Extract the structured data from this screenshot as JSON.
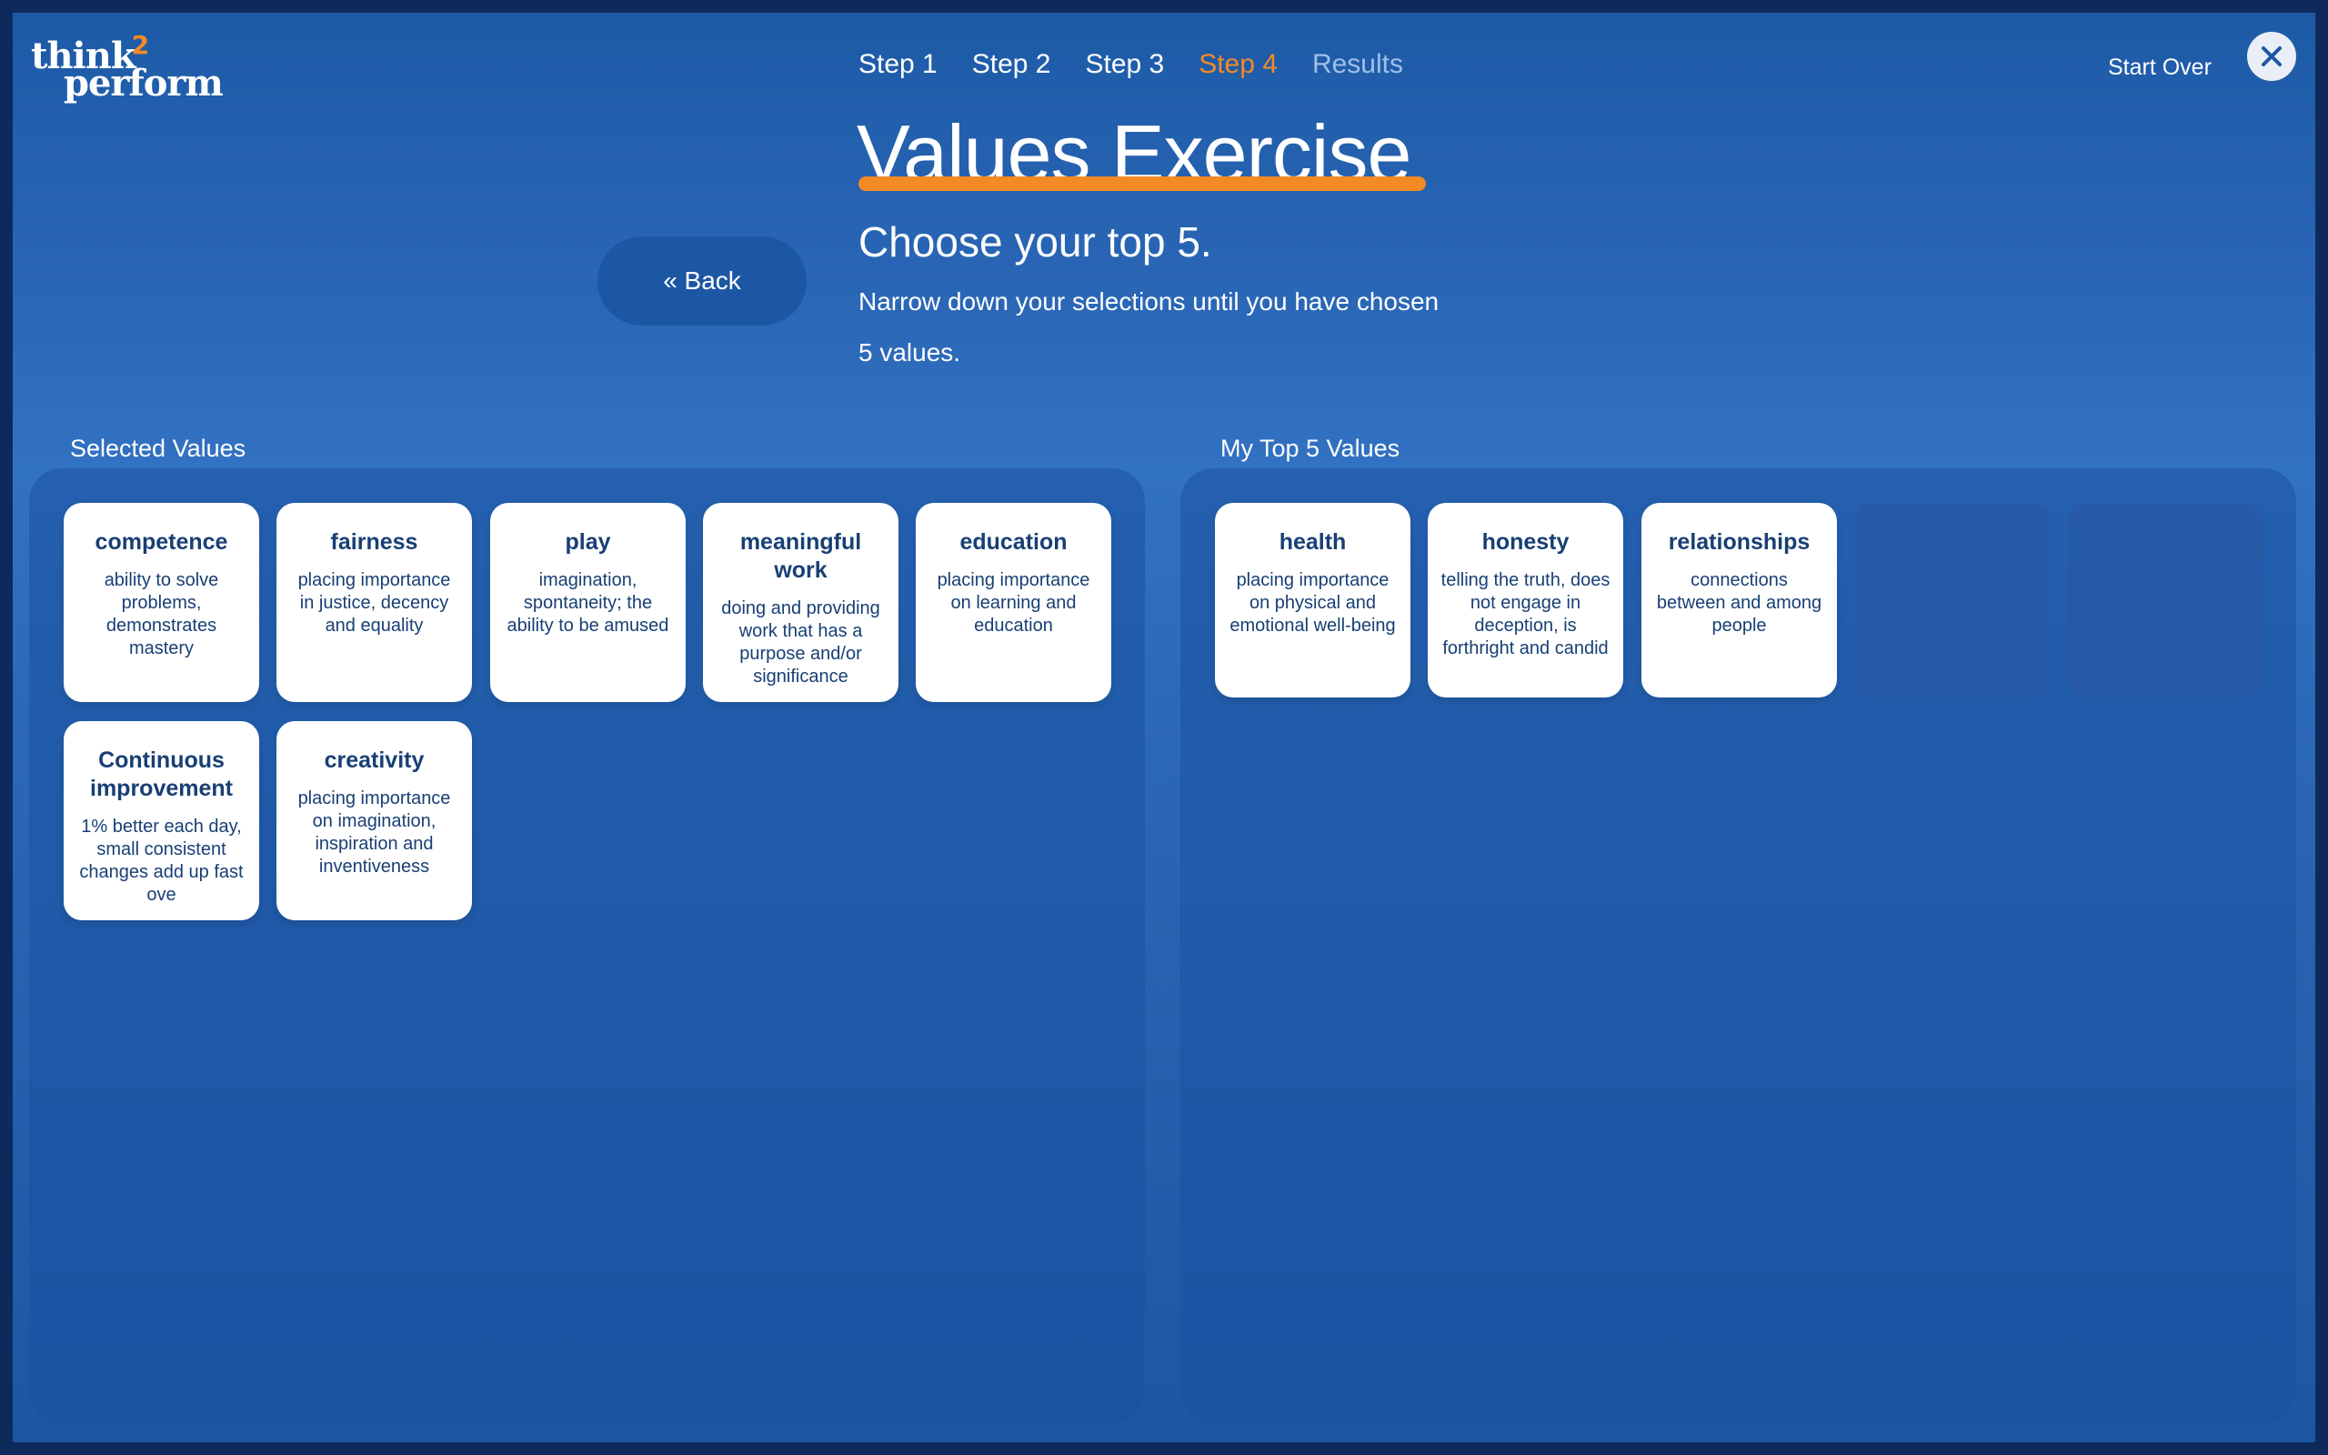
{
  "brand": {
    "logo_line1": "think",
    "logo_super": "2",
    "logo_line2": "perform",
    "accent_color": "#f28a26"
  },
  "nav": {
    "steps": [
      "Step 1",
      "Step 2",
      "Step 3",
      "Step 4",
      "Results"
    ],
    "active_step": "Step 4",
    "start_over": "Start Over",
    "close_icon": "close-icon"
  },
  "header": {
    "title": "Values Exercise",
    "subtitle": "Choose your top 5.",
    "description": "Narrow down your selections until you have chosen 5 values.",
    "back_label": "« Back"
  },
  "selected_panel": {
    "label": "Selected Values",
    "cards": [
      {
        "name": "competence",
        "definition": "ability to solve problems, demonstrates mastery"
      },
      {
        "name": "fairness",
        "definition": "placing importance in justice, decency and equality"
      },
      {
        "name": "play",
        "definition": "imagination, spontaneity; the ability to be amused"
      },
      {
        "name": "meaningful work",
        "definition": "doing and providing work that has a purpose and/or significance"
      },
      {
        "name": "education",
        "definition": "placing importance on learning and education"
      },
      {
        "name": "Continuous improvement",
        "definition": "1% better each day, small consistent changes add up fast ove"
      },
      {
        "name": "creativity",
        "definition": "placing importance on imagination, inspiration and inventiveness"
      }
    ]
  },
  "top5_panel": {
    "label": "My Top 5 Values",
    "cards": [
      {
        "name": "health",
        "definition": "placing importance on physical and emotional well-being"
      },
      {
        "name": "honesty",
        "definition": "telling the truth, does not engage in deception, is forthright and candid"
      },
      {
        "name": "relationships",
        "definition": "connections between and among people"
      }
    ],
    "empty_slots": 2
  }
}
